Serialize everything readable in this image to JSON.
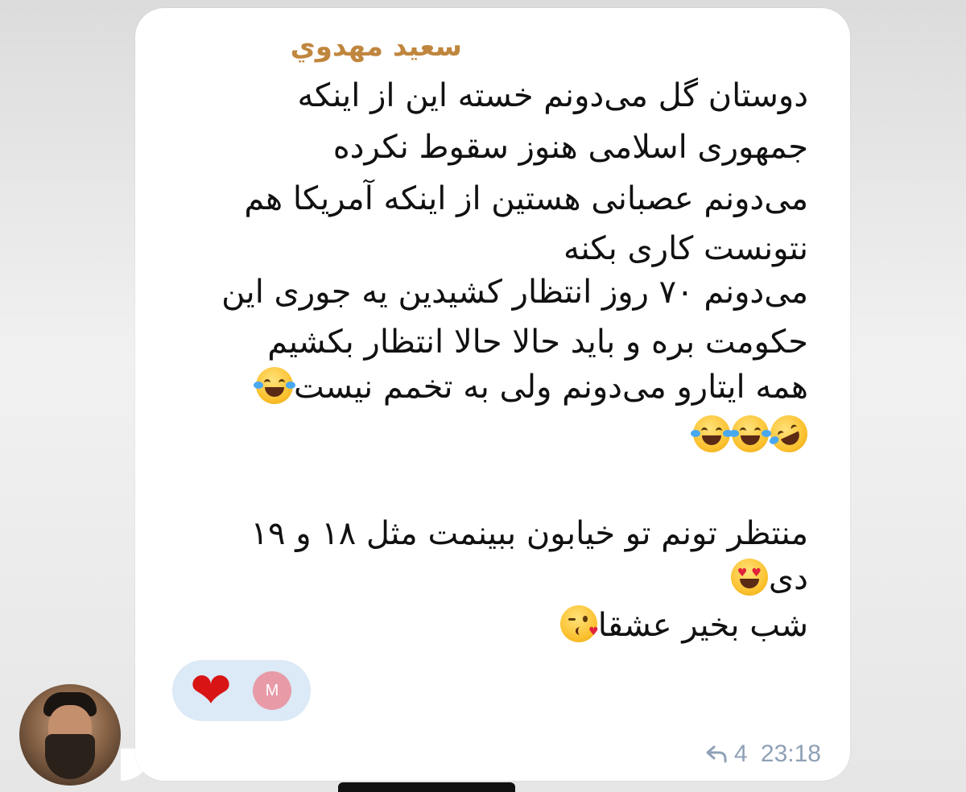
{
  "message": {
    "sender_name": "سعيد مهدوي",
    "lines": [
      "دوستان گل می‌دونم خسته این از اینکه",
      "جمهوری اسلامی هنوز سقوط نکرده",
      "می‌دونم عصبانی هستین از اینکه آمریکا هم",
      "نتونست کاری بکنه",
      "می‌دونم ۷۰ روز انتظار کشیدین یه جوری این",
      "حکومت بره و باید حالا حالا انتظار بکشیم",
      "همه ایتارو می‌دونم ولی به تخمم نیست",
      "منتظر تونم تو خیابون ببینمت مثل ۱۸ و ۱۹",
      "دی",
      "شب بخیر عشقا"
    ],
    "emojis": [
      "face-with-tears-of-joy",
      "rolling-on-the-floor-laughing",
      "smiling-face-with-heart-eyes",
      "face-blowing-a-kiss"
    ],
    "reactions": {
      "emoji": "❤",
      "reactor_initial": "M"
    },
    "reply_count": "4",
    "time": "23:18"
  },
  "colors": {
    "sender_name": "#c0863e",
    "reaction_pill": "#dce9f6",
    "meta_text": "#8fa1b6",
    "avatar_m": "#e89aa7"
  }
}
